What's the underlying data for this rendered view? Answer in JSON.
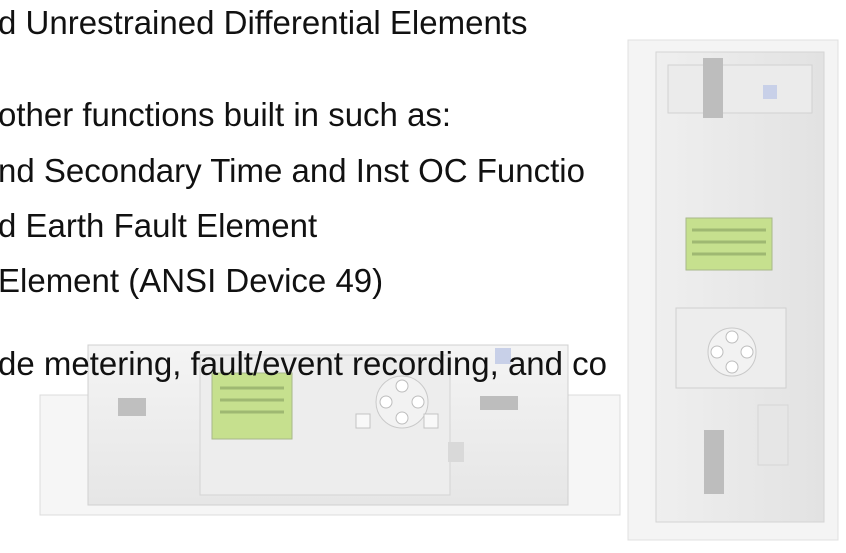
{
  "slide": {
    "lines": [
      "d Unrestrained Differential Elements",
      "other functions built in such as:",
      "nd Secondary Time and Inst OC Functio",
      "d Earth Fault Element",
      "Element (ANSI Device 49)",
      "de metering, fault/event recording, and co"
    ]
  },
  "colors": {
    "text": "#111111",
    "device_body": "#f2f2f2",
    "lcd": "#c6e08e"
  },
  "icons": [
    "relay-horizontal-image",
    "relay-vertical-image"
  ]
}
